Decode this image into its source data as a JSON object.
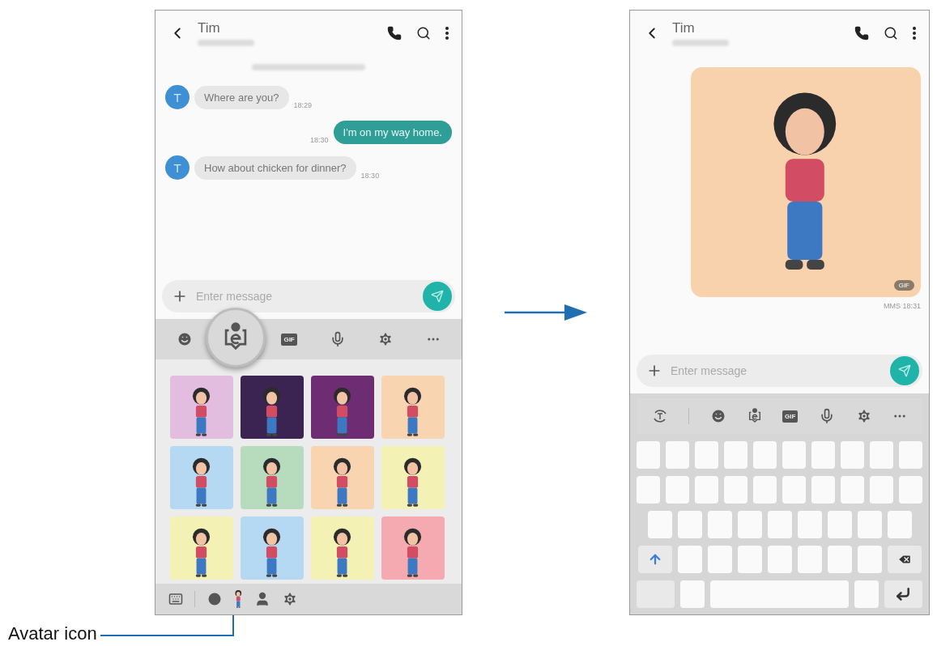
{
  "screens": [
    {
      "kind": "stickers",
      "contact": "Tim",
      "messages": [
        {
          "kind": "received",
          "avatar": "T",
          "text": "Where are you?",
          "time": "18:29"
        },
        {
          "kind": "sent",
          "text": "I'm on my way home.",
          "time": "18:30"
        },
        {
          "kind": "received",
          "avatar": "T",
          "text": "How about chicken for dinner?",
          "time": "18:30"
        }
      ],
      "input": {
        "placeholder": "Enter message"
      },
      "toolbar": {
        "gif": "GIF"
      },
      "stickers": [
        {
          "color": "#e2bde0"
        },
        {
          "color": "#3b2452"
        },
        {
          "color": "#6e2d72"
        },
        {
          "color": "#f9d4b0"
        },
        {
          "color": "#b5d9f3"
        },
        {
          "color": "#b7dcbd"
        },
        {
          "color": "#f9d4b0"
        },
        {
          "color": "#f3f1b3"
        },
        {
          "color": "#f3f1b3"
        },
        {
          "color": "#b5d9f3"
        },
        {
          "color": "#f3f1b3"
        },
        {
          "color": "#f5aab2"
        }
      ]
    },
    {
      "kind": "keyboard",
      "contact": "Tim",
      "image_message": {
        "badge": "GIF",
        "meta": "MMS 18:31"
      },
      "input": {
        "placeholder": "Enter message"
      },
      "toolbar": {
        "gif": "GIF"
      }
    }
  ],
  "annotation": {
    "label": "Avatar icon"
  }
}
